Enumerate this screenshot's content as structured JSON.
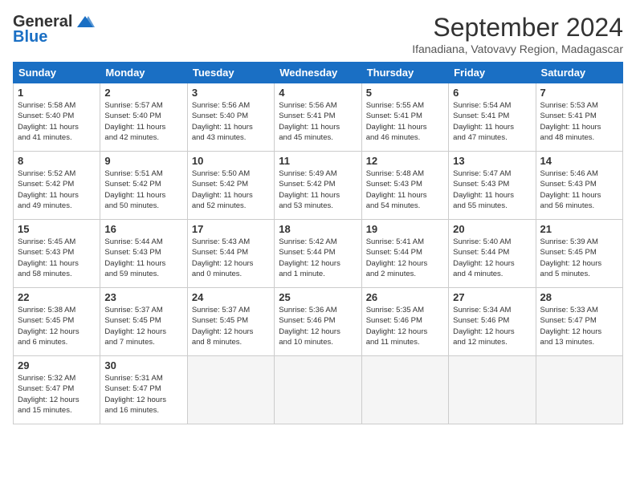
{
  "header": {
    "logo_line1": "General",
    "logo_line2": "Blue",
    "month": "September 2024",
    "location": "Ifanadiana, Vatovavy Region, Madagascar"
  },
  "days_of_week": [
    "Sunday",
    "Monday",
    "Tuesday",
    "Wednesday",
    "Thursday",
    "Friday",
    "Saturday"
  ],
  "weeks": [
    [
      {
        "day": "1",
        "lines": [
          "Sunrise: 5:58 AM",
          "Sunset: 5:40 PM",
          "Daylight: 11 hours",
          "and 41 minutes."
        ]
      },
      {
        "day": "2",
        "lines": [
          "Sunrise: 5:57 AM",
          "Sunset: 5:40 PM",
          "Daylight: 11 hours",
          "and 42 minutes."
        ]
      },
      {
        "day": "3",
        "lines": [
          "Sunrise: 5:56 AM",
          "Sunset: 5:40 PM",
          "Daylight: 11 hours",
          "and 43 minutes."
        ]
      },
      {
        "day": "4",
        "lines": [
          "Sunrise: 5:56 AM",
          "Sunset: 5:41 PM",
          "Daylight: 11 hours",
          "and 45 minutes."
        ]
      },
      {
        "day": "5",
        "lines": [
          "Sunrise: 5:55 AM",
          "Sunset: 5:41 PM",
          "Daylight: 11 hours",
          "and 46 minutes."
        ]
      },
      {
        "day": "6",
        "lines": [
          "Sunrise: 5:54 AM",
          "Sunset: 5:41 PM",
          "Daylight: 11 hours",
          "and 47 minutes."
        ]
      },
      {
        "day": "7",
        "lines": [
          "Sunrise: 5:53 AM",
          "Sunset: 5:41 PM",
          "Daylight: 11 hours",
          "and 48 minutes."
        ]
      }
    ],
    [
      {
        "day": "8",
        "lines": [
          "Sunrise: 5:52 AM",
          "Sunset: 5:42 PM",
          "Daylight: 11 hours",
          "and 49 minutes."
        ]
      },
      {
        "day": "9",
        "lines": [
          "Sunrise: 5:51 AM",
          "Sunset: 5:42 PM",
          "Daylight: 11 hours",
          "and 50 minutes."
        ]
      },
      {
        "day": "10",
        "lines": [
          "Sunrise: 5:50 AM",
          "Sunset: 5:42 PM",
          "Daylight: 11 hours",
          "and 52 minutes."
        ]
      },
      {
        "day": "11",
        "lines": [
          "Sunrise: 5:49 AM",
          "Sunset: 5:42 PM",
          "Daylight: 11 hours",
          "and 53 minutes."
        ]
      },
      {
        "day": "12",
        "lines": [
          "Sunrise: 5:48 AM",
          "Sunset: 5:43 PM",
          "Daylight: 11 hours",
          "and 54 minutes."
        ]
      },
      {
        "day": "13",
        "lines": [
          "Sunrise: 5:47 AM",
          "Sunset: 5:43 PM",
          "Daylight: 11 hours",
          "and 55 minutes."
        ]
      },
      {
        "day": "14",
        "lines": [
          "Sunrise: 5:46 AM",
          "Sunset: 5:43 PM",
          "Daylight: 11 hours",
          "and 56 minutes."
        ]
      }
    ],
    [
      {
        "day": "15",
        "lines": [
          "Sunrise: 5:45 AM",
          "Sunset: 5:43 PM",
          "Daylight: 11 hours",
          "and 58 minutes."
        ]
      },
      {
        "day": "16",
        "lines": [
          "Sunrise: 5:44 AM",
          "Sunset: 5:43 PM",
          "Daylight: 11 hours",
          "and 59 minutes."
        ]
      },
      {
        "day": "17",
        "lines": [
          "Sunrise: 5:43 AM",
          "Sunset: 5:44 PM",
          "Daylight: 12 hours",
          "and 0 minutes."
        ]
      },
      {
        "day": "18",
        "lines": [
          "Sunrise: 5:42 AM",
          "Sunset: 5:44 PM",
          "Daylight: 12 hours",
          "and 1 minute."
        ]
      },
      {
        "day": "19",
        "lines": [
          "Sunrise: 5:41 AM",
          "Sunset: 5:44 PM",
          "Daylight: 12 hours",
          "and 2 minutes."
        ]
      },
      {
        "day": "20",
        "lines": [
          "Sunrise: 5:40 AM",
          "Sunset: 5:44 PM",
          "Daylight: 12 hours",
          "and 4 minutes."
        ]
      },
      {
        "day": "21",
        "lines": [
          "Sunrise: 5:39 AM",
          "Sunset: 5:45 PM",
          "Daylight: 12 hours",
          "and 5 minutes."
        ]
      }
    ],
    [
      {
        "day": "22",
        "lines": [
          "Sunrise: 5:38 AM",
          "Sunset: 5:45 PM",
          "Daylight: 12 hours",
          "and 6 minutes."
        ]
      },
      {
        "day": "23",
        "lines": [
          "Sunrise: 5:37 AM",
          "Sunset: 5:45 PM",
          "Daylight: 12 hours",
          "and 7 minutes."
        ]
      },
      {
        "day": "24",
        "lines": [
          "Sunrise: 5:37 AM",
          "Sunset: 5:45 PM",
          "Daylight: 12 hours",
          "and 8 minutes."
        ]
      },
      {
        "day": "25",
        "lines": [
          "Sunrise: 5:36 AM",
          "Sunset: 5:46 PM",
          "Daylight: 12 hours",
          "and 10 minutes."
        ]
      },
      {
        "day": "26",
        "lines": [
          "Sunrise: 5:35 AM",
          "Sunset: 5:46 PM",
          "Daylight: 12 hours",
          "and 11 minutes."
        ]
      },
      {
        "day": "27",
        "lines": [
          "Sunrise: 5:34 AM",
          "Sunset: 5:46 PM",
          "Daylight: 12 hours",
          "and 12 minutes."
        ]
      },
      {
        "day": "28",
        "lines": [
          "Sunrise: 5:33 AM",
          "Sunset: 5:47 PM",
          "Daylight: 12 hours",
          "and 13 minutes."
        ]
      }
    ],
    [
      {
        "day": "29",
        "lines": [
          "Sunrise: 5:32 AM",
          "Sunset: 5:47 PM",
          "Daylight: 12 hours",
          "and 15 minutes."
        ]
      },
      {
        "day": "30",
        "lines": [
          "Sunrise: 5:31 AM",
          "Sunset: 5:47 PM",
          "Daylight: 12 hours",
          "and 16 minutes."
        ]
      },
      {
        "day": "",
        "lines": []
      },
      {
        "day": "",
        "lines": []
      },
      {
        "day": "",
        "lines": []
      },
      {
        "day": "",
        "lines": []
      },
      {
        "day": "",
        "lines": []
      }
    ]
  ]
}
